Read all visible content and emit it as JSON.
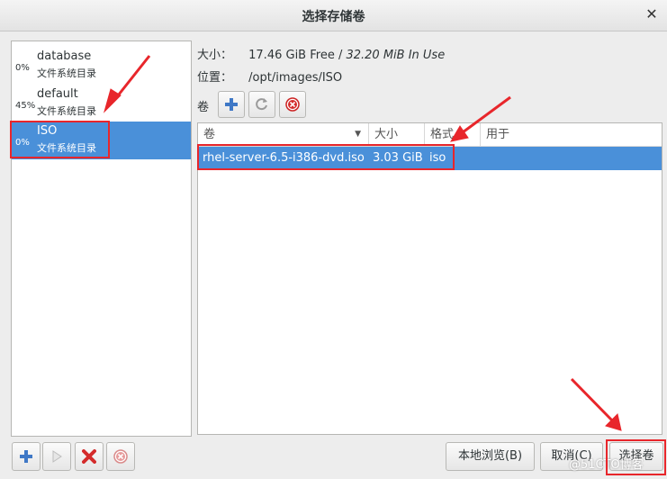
{
  "window": {
    "title": "选择存储卷",
    "close_glyph": "✕"
  },
  "pools": [
    {
      "percent": "0%",
      "name": "database",
      "type": "文件系统目录",
      "selected": false
    },
    {
      "percent": "45%",
      "name": "default",
      "type": "文件系统目录",
      "selected": false
    },
    {
      "percent": "0%",
      "name": "ISO",
      "type": "文件系统目录",
      "selected": true
    }
  ],
  "info": {
    "size_label": "大小：",
    "free": "17.46 GiB Free /",
    "in_use": "32.20 MiB In Use",
    "location_label": "位置：",
    "location": "/opt/images/ISO"
  },
  "volumes": {
    "label": "卷",
    "columns": [
      "卷",
      "大小",
      "格式",
      "用于"
    ],
    "rows": [
      {
        "name": "rhel-server-6.5-i386-dvd.iso",
        "size": "3.03 GiB",
        "format": "iso",
        "used_by": ""
      }
    ]
  },
  "buttons": {
    "browse_local": "本地浏览(B)",
    "cancel": "取消(C)",
    "choose_volume": "选择卷"
  },
  "watermark": "@51CTO博客",
  "colors": {
    "selection": "#4a90d9",
    "annotation": "#e8262b"
  }
}
